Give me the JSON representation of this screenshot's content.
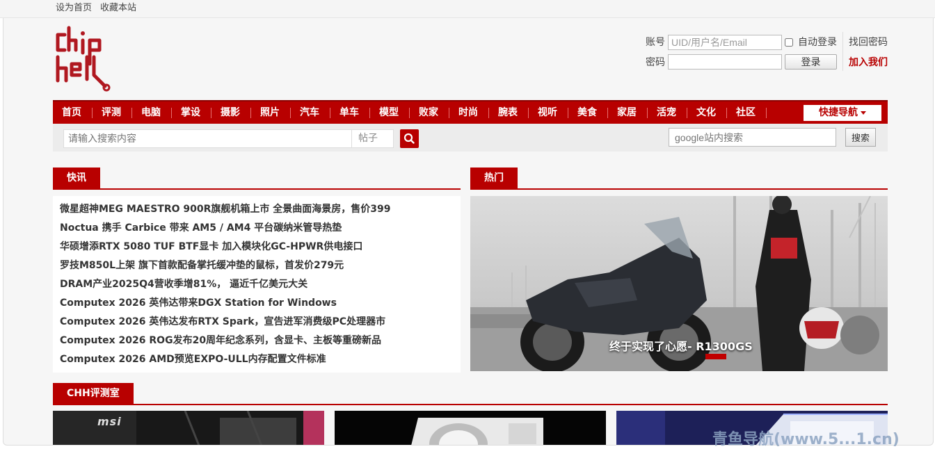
{
  "topbar": {
    "set_home": "设为首页",
    "bookmark": "收藏本站"
  },
  "login": {
    "account_label": "账号",
    "password_label": "密码",
    "account_placeholder": "UID/用户名/Email",
    "auto_login": "自动登录",
    "login_button": "登录",
    "forgot_password": "找回密码",
    "join_us": "加入我们"
  },
  "nav": {
    "items": [
      "首页",
      "评测",
      "电脑",
      "掌设",
      "摄影",
      "照片",
      "汽车",
      "单车",
      "模型",
      "败家",
      "时尚",
      "腕表",
      "视听",
      "美食",
      "家居",
      "活宠",
      "文化",
      "社区"
    ],
    "quick_nav": "快捷导航"
  },
  "search": {
    "placeholder": "请输入搜索内容",
    "type": "帖子",
    "google_placeholder": "google站内搜索",
    "google_button": "搜索"
  },
  "sections": {
    "news_title": "快讯",
    "hot_title": "热门",
    "lab_title": "CHH评测室"
  },
  "news": [
    "微星超神MEG MAESTRO 900R旗舰机箱上市 全景曲面海景房，售价399",
    "Noctua 携手 Carbice 带来 AM5 / AM4 平台碳纳米管导热垫",
    "华硕增添RTX 5080 TUF BTF显卡 加入模块化GC-HPWR供电接口",
    "罗技M850L上架 旗下首款配备掌托缓冲垫的鼠标，首发价279元",
    "DRAM产业2025Q4营收季增81%， 逼近千亿美元大关",
    "Computex 2026 英伟达带来DGX Station for Windows",
    "Computex 2026 英伟达发布RTX Spark，宣告进军消费级PC处理器市",
    "Computex 2026 ROG发布20周年纪念系列，含显卡、主板等重磅新品",
    "Computex 2026 AMD预览EXPO-ULL内存配置文件标准"
  ],
  "hot": {
    "caption": "终于实现了心愿- R1300GS"
  },
  "thumbs": {
    "brand_text": "msi"
  },
  "watermark": "青鱼导航(www.5...1.cn)",
  "colors": {
    "brand_red": "#b80000",
    "page_bg": "#f6f6f6"
  }
}
